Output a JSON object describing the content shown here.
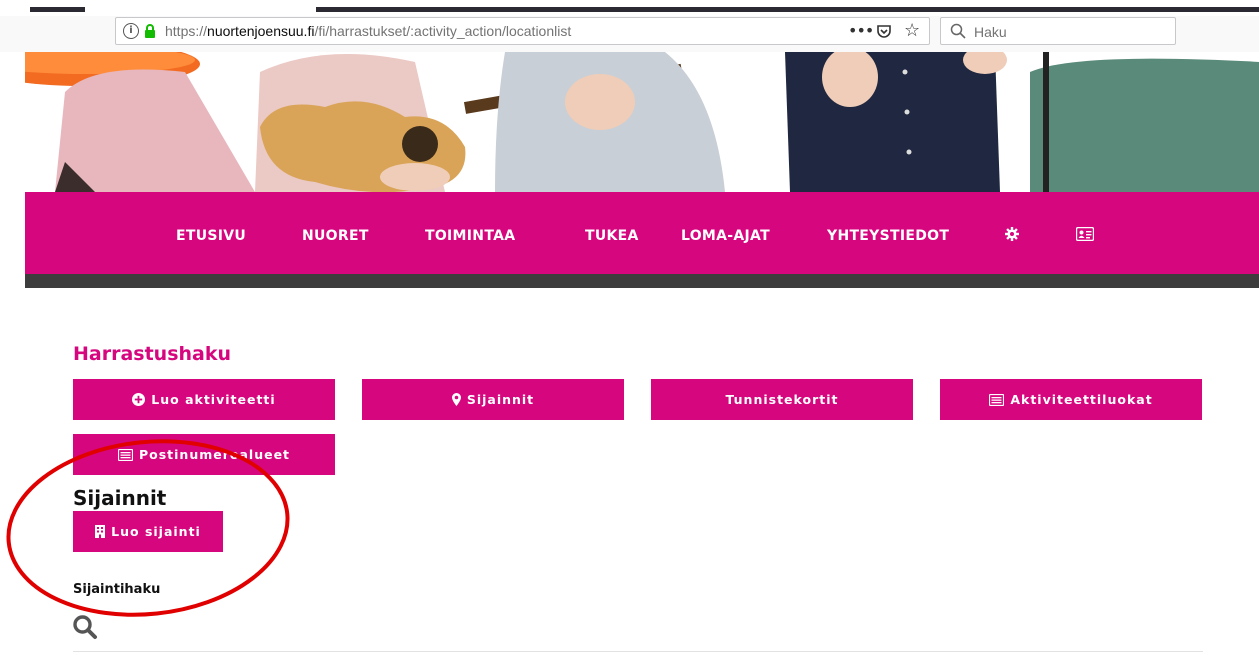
{
  "browser": {
    "url_prefix": "https://",
    "url_host": "nuortenjoensuu.fi",
    "url_path": "/fi/harrastukset/:activity_action/locationlist",
    "more_label": "•••",
    "search_placeholder": "Haku"
  },
  "nav": {
    "items": [
      {
        "label": "ETUSIVU"
      },
      {
        "label": "NUORET"
      },
      {
        "label": "TOIMINTAA"
      },
      {
        "label": "TUKEA"
      },
      {
        "label": "LOMA-AJAT"
      },
      {
        "label": "YHTEYSTIEDOT"
      }
    ],
    "icons": [
      "gear-icon",
      "id-card-icon"
    ]
  },
  "content": {
    "page_title": "Harrastushaku",
    "buttons": [
      {
        "label": "Luo aktiviteetti",
        "icon": "plus-circle-icon"
      },
      {
        "label": "Sijainnit",
        "icon": "map-marker-icon"
      },
      {
        "label": "Tunnistekortit",
        "icon": ""
      },
      {
        "label": "Aktiviteettiluokat",
        "icon": "list-alt-icon"
      },
      {
        "label": "Postinumeroalueet",
        "icon": "list-alt-icon"
      }
    ],
    "section_title": "Sijainnit",
    "create_button": {
      "label": "Luo sijainti",
      "icon": "building-icon"
    },
    "subsection_title": "Sijaintihaku",
    "search_icon": "search-icon"
  },
  "colors": {
    "brand_magenta": "#d6067f",
    "nav_strip": "#3d3d3d",
    "annotation_red": "#e00000"
  }
}
